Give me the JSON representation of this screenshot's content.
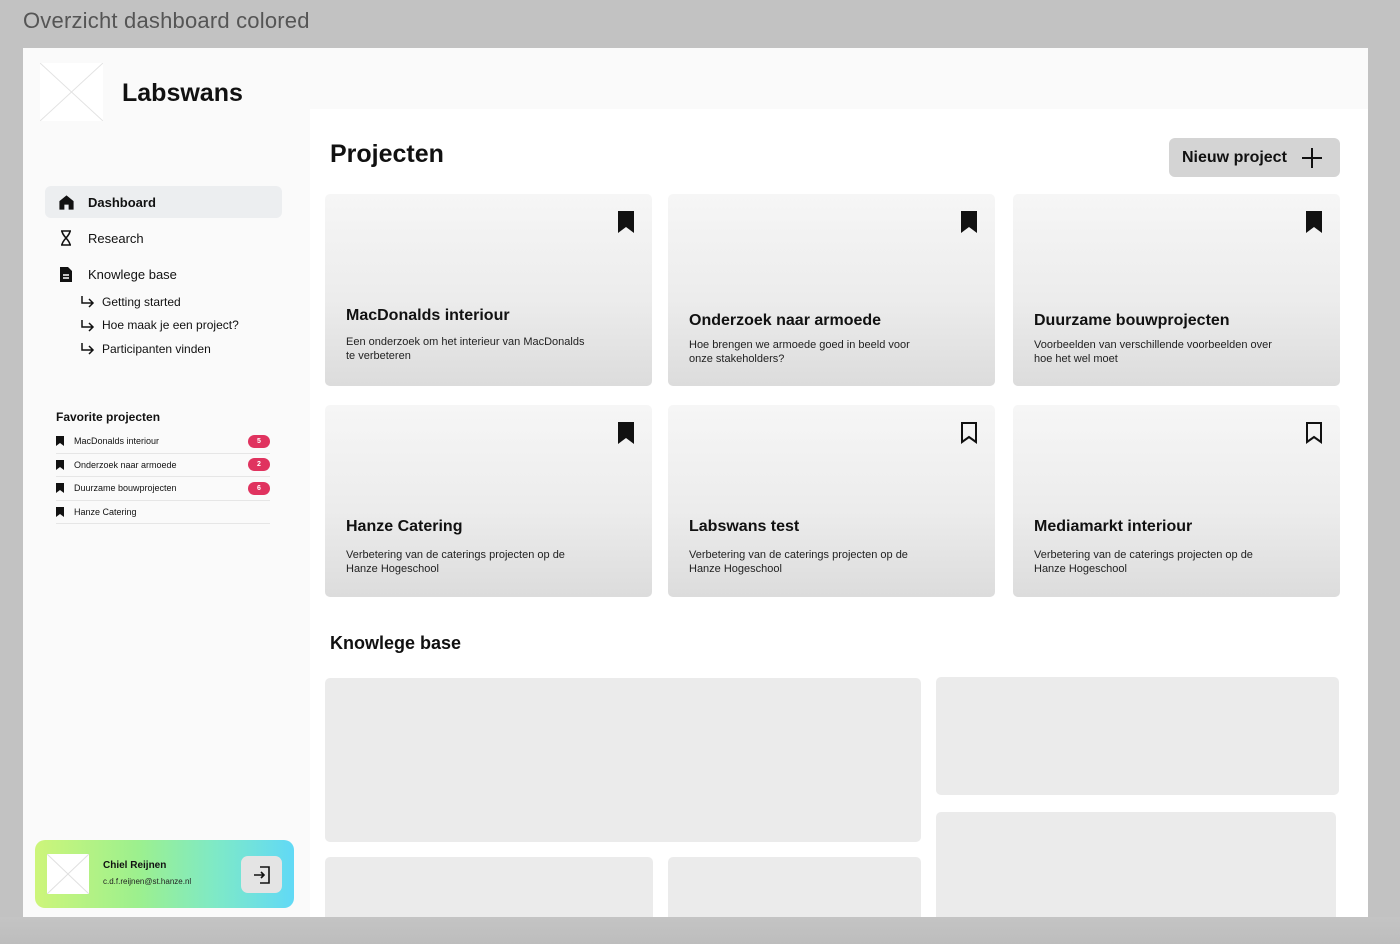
{
  "frame": {
    "title": "Overzicht dashboard colored"
  },
  "brand": {
    "name": "Labswans"
  },
  "nav": {
    "items": [
      {
        "label": "Dashboard",
        "icon": "home-icon",
        "active": true
      },
      {
        "label": "Research",
        "icon": "hourglass-icon",
        "active": false
      },
      {
        "label": "Knowlege base",
        "icon": "document-icon",
        "active": false
      }
    ],
    "sub_items": [
      {
        "label": "Getting started"
      },
      {
        "label": "Hoe maak je een project?"
      },
      {
        "label": "Participanten vinden"
      }
    ]
  },
  "favorites": {
    "title": "Favorite projecten",
    "items": [
      {
        "name": "MacDonalds interiour",
        "count": "5"
      },
      {
        "name": "Onderzoek naar armoede",
        "count": "2"
      },
      {
        "name": "Duurzame bouwprojecten",
        "count": "6"
      },
      {
        "name": "Hanze Catering",
        "count": ""
      }
    ],
    "badge_color": "#e0335f"
  },
  "user": {
    "name": "Chiel Reijnen",
    "email": "c.d.f.reijnen@st.hanze.nl"
  },
  "main": {
    "projects_title": "Projecten",
    "new_button": "Nieuw project",
    "knowledge_title": "Knowlege base"
  },
  "projects": [
    {
      "title": "MacDonalds interiour",
      "desc": "Een onderzoek om het interieur van MacDonalds te verbeteren",
      "bookmarked": true
    },
    {
      "title": "Onderzoek naar armoede",
      "desc": "Hoe brengen we armoede goed in beeld voor onze stakeholders?",
      "bookmarked": true
    },
    {
      "title": "Duurzame bouwprojecten",
      "desc": "Voorbeelden van verschillende voorbeelden over hoe het wel moet",
      "bookmarked": true
    },
    {
      "title": "Hanze Catering",
      "desc": "Verbetering van de caterings projecten op de Hanze Hogeschool",
      "bookmarked": true
    },
    {
      "title": "Labswans test",
      "desc": "Verbetering van de caterings projecten op de Hanze Hogeschool",
      "bookmarked": false
    },
    {
      "title": "Mediamarkt interiour",
      "desc": "Verbetering van de caterings projecten op de Hanze Hogeschool",
      "bookmarked": false
    }
  ]
}
